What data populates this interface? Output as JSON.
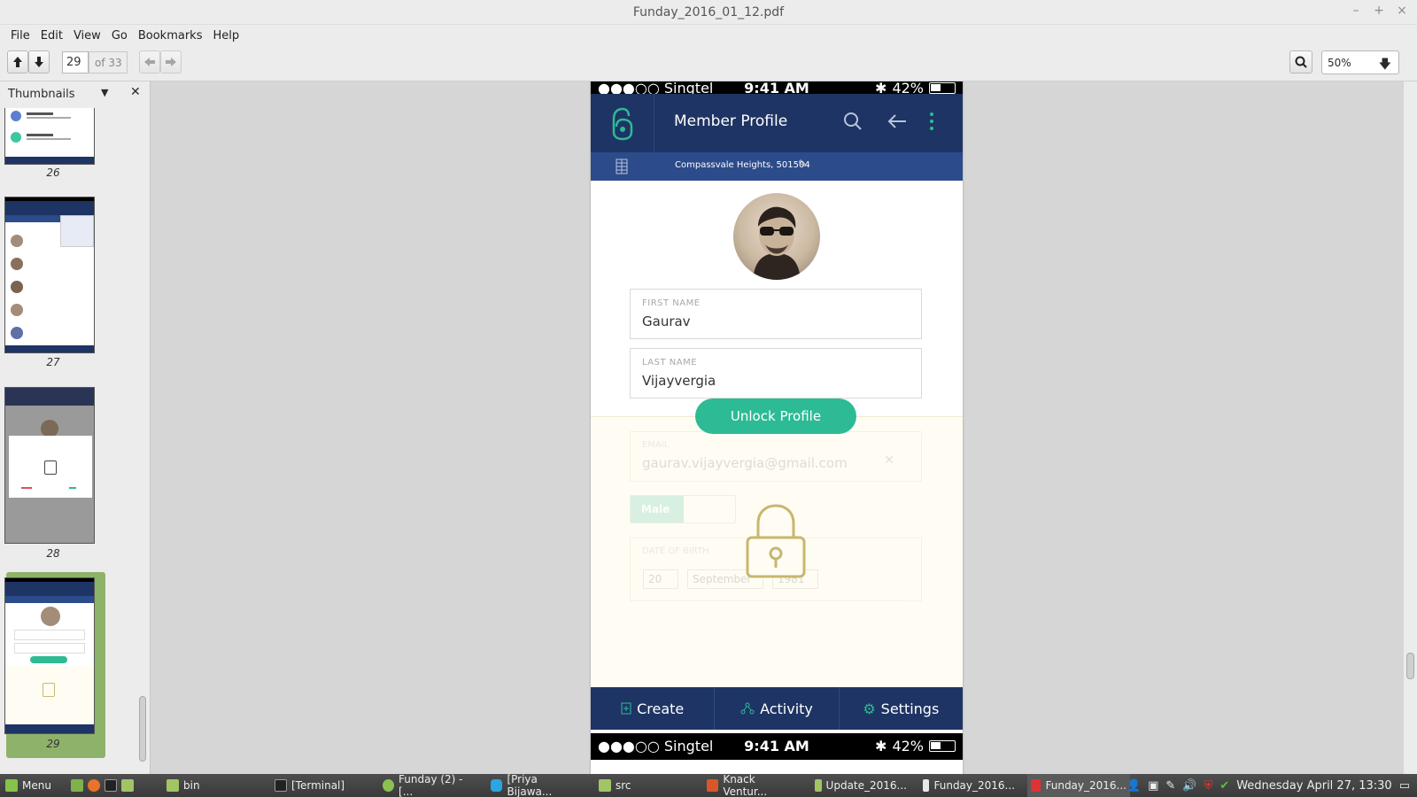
{
  "window": {
    "title": "Funday_2016_01_12.pdf",
    "minimize": "–",
    "maximize": "+",
    "close": "×"
  },
  "menu": [
    "File",
    "Edit",
    "View",
    "Go",
    "Bookmarks",
    "Help"
  ],
  "toolbar": {
    "page_current": "29",
    "page_total": "of 33",
    "zoom": "50%"
  },
  "sidebar": {
    "title": "Thumbnails",
    "pages": [
      "26",
      "27",
      "28",
      "29"
    ]
  },
  "phone": {
    "carrier": "●●●○○ Singtel",
    "time": "9:41 AM",
    "battery": "42%",
    "header_title": "Member Profile",
    "address": "Compassvale Heights, 501504",
    "first_name_label": "FIRST NAME",
    "first_name": "Gaurav",
    "last_name_label": "LAST NAME",
    "last_name": "Vijayvergia",
    "unlock_label": "Unlock Profile",
    "email_label": "EMAIL",
    "email": "gaurav.vijayvergia@gmail.com",
    "gender": "Male",
    "dob_label": "DATE OF BIRTH",
    "dob_day": "20",
    "dob_month": "September",
    "dob_year": "1981",
    "nav": [
      "Create",
      "Activity",
      "Settings"
    ],
    "accent": "#2dbb95",
    "header_color": "#1e3464"
  },
  "taskbar": {
    "menu_label": "Menu",
    "items": [
      "bin",
      "[Terminal]",
      "Funday (2) - [...",
      "[Priya Bijawa...",
      "src",
      "Knack Ventur...",
      "Update_2016...",
      "Funday_2016...",
      "Funday_2016..."
    ],
    "clock": "Wednesday April 27, 13:30"
  }
}
